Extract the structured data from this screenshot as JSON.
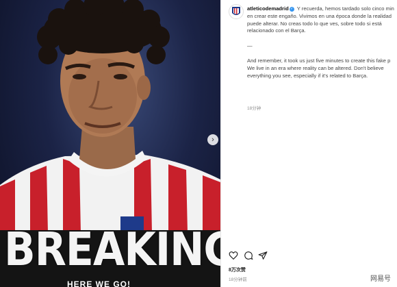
{
  "post": {
    "image": {
      "headline": "BREAKING",
      "subline": "HERE WE GO!",
      "next_icon": "chevron-right-icon"
    },
    "account": {
      "username": "atleticodemadrid",
      "verified": true
    },
    "caption": {
      "spanish_1": "Y recuerda, hemos tardado solo cinco min",
      "spanish_2": "en crear este engaño. Vivimos en una época donde la realidad",
      "spanish_3": "puede alterar. No creas todo lo que ves, sobre todo si está",
      "spanish_4": "relacionado con el Barça.",
      "divider": "—",
      "english_1": "And remember, it took us just five minutes to create this fake p",
      "english_2": "We live in an era where reality can be altered. Don't believe",
      "english_3": "everything you see, especially if it's related to Barça."
    },
    "caption_time": "18分钟",
    "likes": "8万次赞",
    "post_time": "18分钟前",
    "watermark": "网易号",
    "colors": {
      "stripe_red": "#c8202b",
      "verified": "#3897f0",
      "dark_bg": "#0b0f22"
    }
  }
}
